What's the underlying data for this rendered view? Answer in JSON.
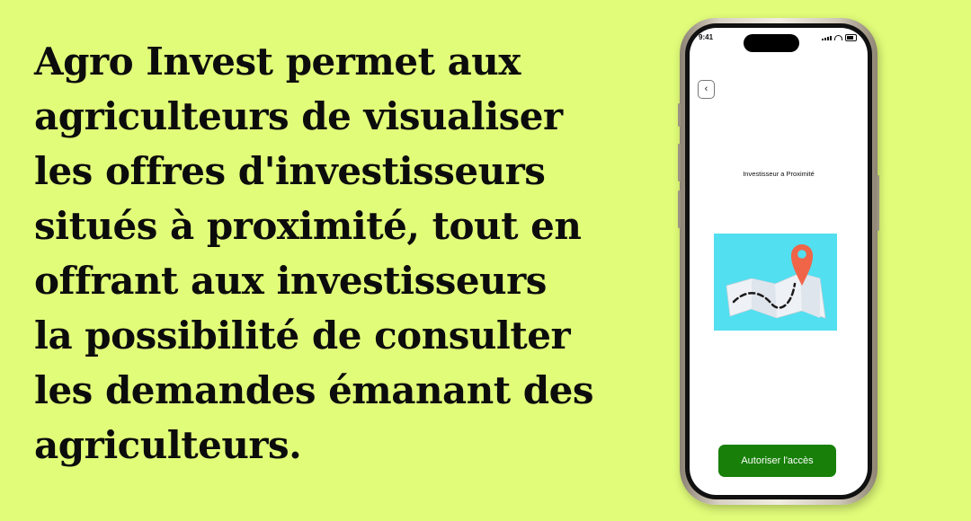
{
  "headline": {
    "lines": [
      "Agro Invest permet aux",
      "agriculteurs de visualiser",
      "les offres d'investisseurs",
      "situés à proximité, tout en",
      "offrant aux investisseurs",
      "la possibilité de consulter",
      "les demandes émanant des",
      "agriculteurs."
    ]
  },
  "phone": {
    "status_time": "9:41",
    "back_glyph": "‹",
    "screen_title": "Investisseur a Proximité",
    "illustration_icon": "map-pin-icon",
    "cta_label": "Autoriser l'accès"
  },
  "colors": {
    "background": "#e1fc79",
    "cta": "#188009",
    "map_bg": "#52dff0",
    "pin": "#f06448"
  }
}
